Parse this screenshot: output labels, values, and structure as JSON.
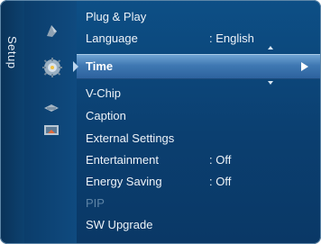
{
  "menu": {
    "category_label": "Setup",
    "icons": [
      "picture-icon",
      "sound-icon",
      "setup-icon",
      "input-icon",
      "application-icon"
    ],
    "selected_item": {
      "label": "Time"
    },
    "items": [
      {
        "label": "Plug & Play",
        "value": ""
      },
      {
        "label": "Language",
        "value": ": English"
      },
      {
        "label": "V-Chip",
        "value": ""
      },
      {
        "label": "Caption",
        "value": ""
      },
      {
        "label": "External Settings",
        "value": ""
      },
      {
        "label": "Entertainment",
        "value": ": Off"
      },
      {
        "label": "Energy Saving",
        "value": ": Off"
      },
      {
        "label": "PIP",
        "value": ""
      },
      {
        "label": "SW Upgrade",
        "value": ""
      }
    ]
  },
  "colors": {
    "background": "#0b3f70",
    "highlight": "#3f78b2",
    "text": "#eef3f8",
    "disabled_text": "#5e84a6"
  }
}
